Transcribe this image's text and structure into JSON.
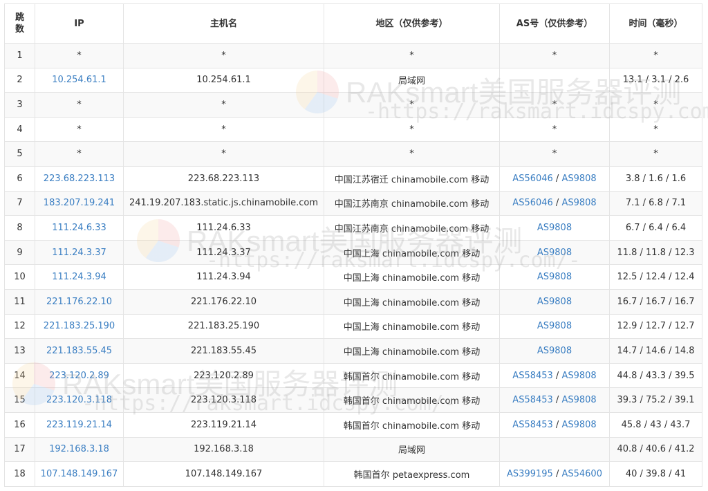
{
  "headers": [
    "跳数",
    "IP",
    "主机名",
    "地区（仅供参考）",
    "AS号（仅供参考）",
    "时间（毫秒）"
  ],
  "rows": [
    {
      "hop": "1",
      "ip": "*",
      "host": "*",
      "region": "*",
      "as": "*",
      "time": "*"
    },
    {
      "hop": "2",
      "ip": "10.254.61.1",
      "host": "10.254.61.1",
      "region": "局域网",
      "as": "",
      "time": "13.1 / 3.1 / 2.6"
    },
    {
      "hop": "3",
      "ip": "*",
      "host": "*",
      "region": "*",
      "as": "*",
      "time": "*"
    },
    {
      "hop": "4",
      "ip": "*",
      "host": "*",
      "region": "*",
      "as": "*",
      "time": "*"
    },
    {
      "hop": "5",
      "ip": "*",
      "host": "*",
      "region": "*",
      "as": "*",
      "time": "*"
    },
    {
      "hop": "6",
      "ip": "223.68.223.113",
      "host": "223.68.223.113",
      "region": "中国江苏宿迁 chinamobile.com 移动",
      "as": "AS56046 / AS9808",
      "time": "3.8 / 1.6 / 1.6"
    },
    {
      "hop": "7",
      "ip": "183.207.19.241",
      "host": "241.19.207.183.static.js.chinamobile.com",
      "region": "中国江苏南京 chinamobile.com 移动",
      "as": "AS56046 / AS9808",
      "time": "7.1 / 6.8 / 7.1"
    },
    {
      "hop": "8",
      "ip": "111.24.6.33",
      "host": "111.24.6.33",
      "region": "中国江苏南京 chinamobile.com 移动",
      "as": "AS9808",
      "time": "6.7 / 6.4 / 6.4"
    },
    {
      "hop": "9",
      "ip": "111.24.3.37",
      "host": "111.24.3.37",
      "region": "中国上海 chinamobile.com 移动",
      "as": "AS9808",
      "time": "11.8 / 11.8 / 12.3"
    },
    {
      "hop": "10",
      "ip": "111.24.3.94",
      "host": "111.24.3.94",
      "region": "中国上海 chinamobile.com 移动",
      "as": "AS9808",
      "time": "12.5 / 12.4 / 12.4"
    },
    {
      "hop": "11",
      "ip": "221.176.22.10",
      "host": "221.176.22.10",
      "region": "中国上海 chinamobile.com 移动",
      "as": "AS9808",
      "time": "16.7 / 16.7 / 16.7"
    },
    {
      "hop": "12",
      "ip": "221.183.25.190",
      "host": "221.183.25.190",
      "region": "中国上海 chinamobile.com 移动",
      "as": "AS9808",
      "time": "12.9 / 12.7 / 12.7"
    },
    {
      "hop": "13",
      "ip": "221.183.55.45",
      "host": "221.183.55.45",
      "region": "中国上海 chinamobile.com 移动",
      "as": "AS9808",
      "time": "14.7 / 14.6 / 14.8"
    },
    {
      "hop": "14",
      "ip": "223.120.2.89",
      "host": "223.120.2.89",
      "region": "韩国首尔 chinamobile.com 移动",
      "as": "AS58453 / AS9808",
      "time": "44.8 / 43.3 / 39.5"
    },
    {
      "hop": "15",
      "ip": "223.120.3.118",
      "host": "223.120.3.118",
      "region": "韩国首尔 chinamobile.com 移动",
      "as": "AS58453 / AS9808",
      "time": "39.3 / 75.2 / 39.1"
    },
    {
      "hop": "16",
      "ip": "223.119.21.14",
      "host": "223.119.21.14",
      "region": "韩国首尔 chinamobile.com 移动",
      "as": "AS58453 / AS9808",
      "time": "45.8 / 43 / 43.7"
    },
    {
      "hop": "17",
      "ip": "192.168.3.18",
      "host": "192.168.3.18",
      "region": "局域网",
      "as": "",
      "time": "40.8 / 40.6 / 41.2"
    },
    {
      "hop": "18",
      "ip": "107.148.149.167",
      "host": "107.148.149.167",
      "region": "韩国首尔 petaexpress.com",
      "as": "AS399195 / AS54600",
      "time": "40 / 39.8 / 41"
    }
  ],
  "watermark": {
    "title": "RAKsmart美国服务器评测",
    "url": "-https://raksmart.idcspy.com/-"
  },
  "colors": {
    "link": "#3a7ec2",
    "border": "#e4e4e4",
    "stripe": "#f9f9f9",
    "text": "#333333"
  }
}
